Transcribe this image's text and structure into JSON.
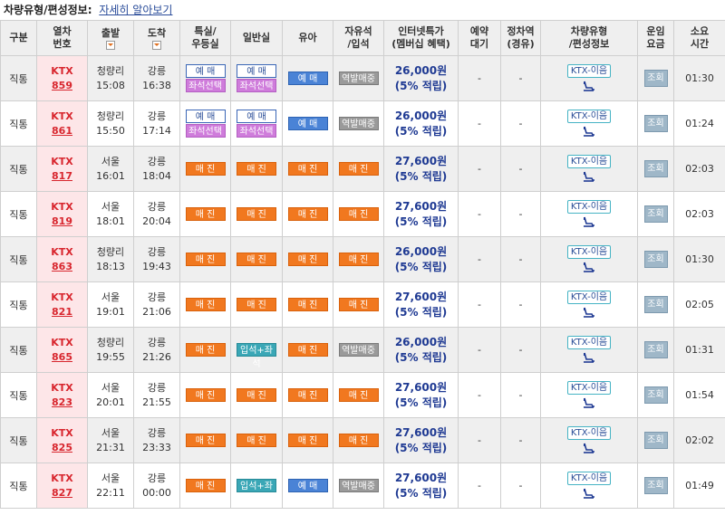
{
  "header_bar": {
    "title": "차량유형/편성정보:",
    "link": "자세히 알아보기"
  },
  "columns": {
    "type": "구분",
    "train_no_1": "열차",
    "train_no_2": "번호",
    "dep": "출발",
    "arr": "도착",
    "special_1": "특실/",
    "special_2": "우등실",
    "general": "일반실",
    "infant": "유아",
    "free_1": "자유석",
    "free_2": "/입석",
    "internet_1": "인터넷특가",
    "internet_2": "(멤버십 혜택)",
    "reserve_1": "예약",
    "reserve_2": "대기",
    "via_1": "정차역",
    "via_2": "(경유)",
    "vehicle_1": "차량유형",
    "vehicle_2": "/편성정보",
    "fare_1": "운임",
    "fare_2": "요금",
    "duration_1": "소요",
    "duration_2": "시간"
  },
  "icons": {
    "dropdown": "dropdown-icon",
    "seat": "seat-icon"
  },
  "colors": {
    "train_red": "#d8262e",
    "sold_orange": "#f1781f",
    "seat_purple": "#cf7cdb",
    "price_blue": "#1f3a93"
  },
  "rows": [
    {
      "type": "직통",
      "brand": "KTX",
      "no": "859",
      "dep_st": "청량리",
      "dep_tm": "15:08",
      "arr_st": "강릉",
      "arr_tm": "16:38",
      "sp1": "예 매",
      "sp2": "좌석선택",
      "gn1": "예 매",
      "gn2": "좌석선택",
      "infant": "예 매",
      "free": "역발매중",
      "price": "26,000원",
      "points": "(5% 적립)",
      "reserve": "-",
      "via": "-",
      "vehicle": "KTX-이음",
      "fare": "조회",
      "duration": "01:30"
    },
    {
      "type": "직통",
      "brand": "KTX",
      "no": "861",
      "dep_st": "청량리",
      "dep_tm": "15:50",
      "arr_st": "강릉",
      "arr_tm": "17:14",
      "sp1": "예 매",
      "sp2": "좌석선택",
      "gn1": "예 매",
      "gn2": "좌석선택",
      "infant": "예 매",
      "free": "역발매중",
      "price": "26,000원",
      "points": "(5% 적립)",
      "reserve": "-",
      "via": "-",
      "vehicle": "KTX-이음",
      "fare": "조회",
      "duration": "01:24"
    },
    {
      "type": "직통",
      "brand": "KTX",
      "no": "817",
      "dep_st": "서울",
      "dep_tm": "16:01",
      "arr_st": "강릉",
      "arr_tm": "18:04",
      "sp1": "매 진",
      "gn1": "매 진",
      "infant": "매 진",
      "free": "매 진",
      "price": "27,600원",
      "points": "(5% 적립)",
      "reserve": "-",
      "via": "-",
      "vehicle": "KTX-이음",
      "fare": "조회",
      "duration": "02:03"
    },
    {
      "type": "직통",
      "brand": "KTX",
      "no": "819",
      "dep_st": "서울",
      "dep_tm": "18:01",
      "arr_st": "강릉",
      "arr_tm": "20:04",
      "sp1": "매 진",
      "gn1": "매 진",
      "infant": "매 진",
      "free": "매 진",
      "price": "27,600원",
      "points": "(5% 적립)",
      "reserve": "-",
      "via": "-",
      "vehicle": "KTX-이음",
      "fare": "조회",
      "duration": "02:03"
    },
    {
      "type": "직통",
      "brand": "KTX",
      "no": "863",
      "dep_st": "청량리",
      "dep_tm": "18:13",
      "arr_st": "강릉",
      "arr_tm": "19:43",
      "sp1": "매 진",
      "gn1": "매 진",
      "infant": "매 진",
      "free": "매 진",
      "price": "26,000원",
      "points": "(5% 적립)",
      "reserve": "-",
      "via": "-",
      "vehicle": "KTX-이음",
      "fare": "조회",
      "duration": "01:30"
    },
    {
      "type": "직통",
      "brand": "KTX",
      "no": "821",
      "dep_st": "서울",
      "dep_tm": "19:01",
      "arr_st": "강릉",
      "arr_tm": "21:06",
      "sp1": "매 진",
      "gn1": "매 진",
      "infant": "매 진",
      "free": "매 진",
      "price": "27,600원",
      "points": "(5% 적립)",
      "reserve": "-",
      "via": "-",
      "vehicle": "KTX-이음",
      "fare": "조회",
      "duration": "02:05"
    },
    {
      "type": "직통",
      "brand": "KTX",
      "no": "865",
      "dep_st": "청량리",
      "dep_tm": "19:55",
      "arr_st": "강릉",
      "arr_tm": "21:26",
      "sp1": "매 진",
      "gn1": "입석+좌석",
      "infant": "매 진",
      "free": "역발매중",
      "price": "26,000원",
      "points": "(5% 적립)",
      "reserve": "-",
      "via": "-",
      "vehicle": "KTX-이음",
      "fare": "조회",
      "duration": "01:31"
    },
    {
      "type": "직통",
      "brand": "KTX",
      "no": "823",
      "dep_st": "서울",
      "dep_tm": "20:01",
      "arr_st": "강릉",
      "arr_tm": "21:55",
      "sp1": "매 진",
      "gn1": "매 진",
      "infant": "매 진",
      "free": "매 진",
      "price": "27,600원",
      "points": "(5% 적립)",
      "reserve": "-",
      "via": "-",
      "vehicle": "KTX-이음",
      "fare": "조회",
      "duration": "01:54"
    },
    {
      "type": "직통",
      "brand": "KTX",
      "no": "825",
      "dep_st": "서울",
      "dep_tm": "21:31",
      "arr_st": "강릉",
      "arr_tm": "23:33",
      "sp1": "매 진",
      "gn1": "매 진",
      "infant": "매 진",
      "free": "매 진",
      "price": "27,600원",
      "points": "(5% 적립)",
      "reserve": "-",
      "via": "-",
      "vehicle": "KTX-이음",
      "fare": "조회",
      "duration": "02:02"
    },
    {
      "type": "직통",
      "brand": "KTX",
      "no": "827",
      "dep_st": "서울",
      "dep_tm": "22:11",
      "arr_st": "강릉",
      "arr_tm": "00:00",
      "sp1": "매 진",
      "gn1": "입석+좌석",
      "infant": "예 매",
      "free": "역발매중",
      "price": "27,600원",
      "points": "(5% 적립)",
      "reserve": "-",
      "via": "-",
      "vehicle": "KTX-이음",
      "fare": "조회",
      "duration": "01:49"
    }
  ]
}
